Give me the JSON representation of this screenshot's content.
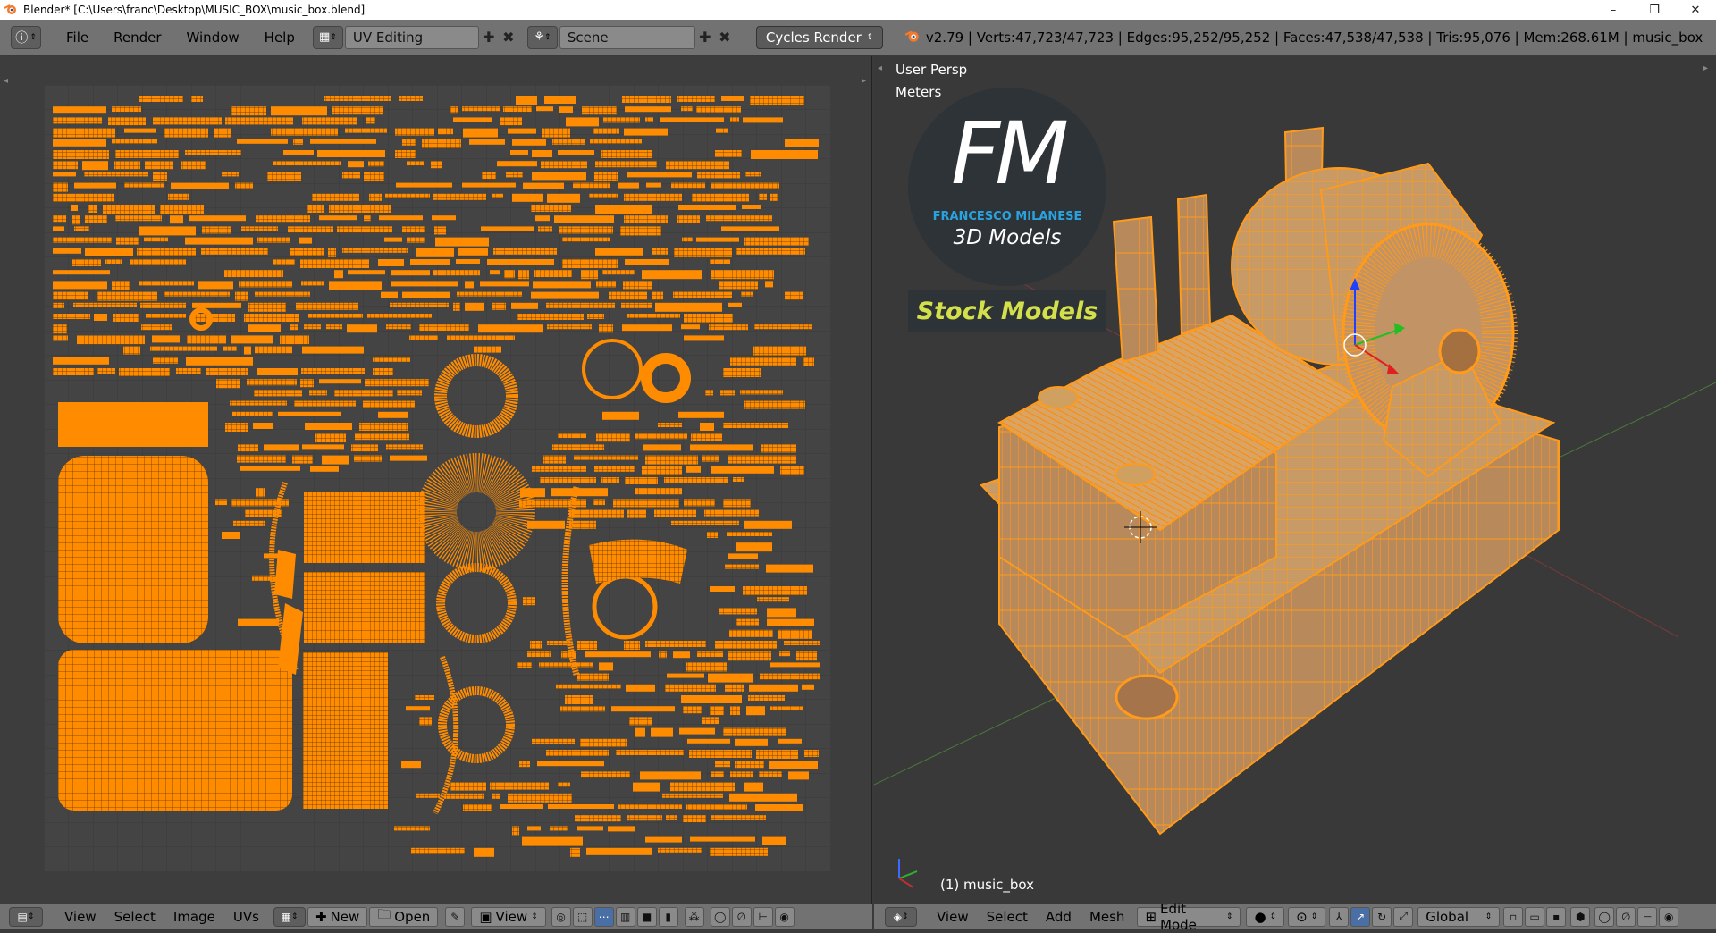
{
  "window": {
    "title": "Blender* [C:\\Users\\franc\\Desktop\\MUSIC_BOX\\music_box.blend]",
    "minimize": "–",
    "restore": "❐",
    "close": "✕"
  },
  "topbar": {
    "menus": [
      "File",
      "Render",
      "Window",
      "Help"
    ],
    "screen_layout": "UV Editing",
    "scene": "Scene",
    "render_engine": "Cycles Render",
    "stats": "v2.79 | Verts:47,723/47,723 | Edges:95,252/95,252 | Faces:47,538/47,538 | Tris:95,076 | Mem:268.61M | music_box"
  },
  "viewport": {
    "view_name": "User Persp",
    "units": "Meters",
    "object_label": "(1) music_box",
    "logo": {
      "initials": "FM",
      "name": "FRANCESCO MILANESE",
      "tagline": "3D Models",
      "banner": "Stock Models"
    }
  },
  "uv_footer": {
    "menus": [
      "View",
      "Select",
      "Image",
      "UVs"
    ],
    "new_label": "New",
    "open_label": "Open",
    "view_label": "View"
  },
  "vp_footer": {
    "menus": [
      "View",
      "Select",
      "Add",
      "Mesh"
    ],
    "mode": "Edit Mode",
    "orientation": "Global"
  },
  "colors": {
    "uv_orange": "#ff8c00",
    "wire_orange": "#ff9a1a",
    "bg_dark": "#3d3d3d",
    "header_gray": "#727272",
    "logo_blue": "#29a3e0",
    "banner_yellow": "#d4e04a"
  }
}
